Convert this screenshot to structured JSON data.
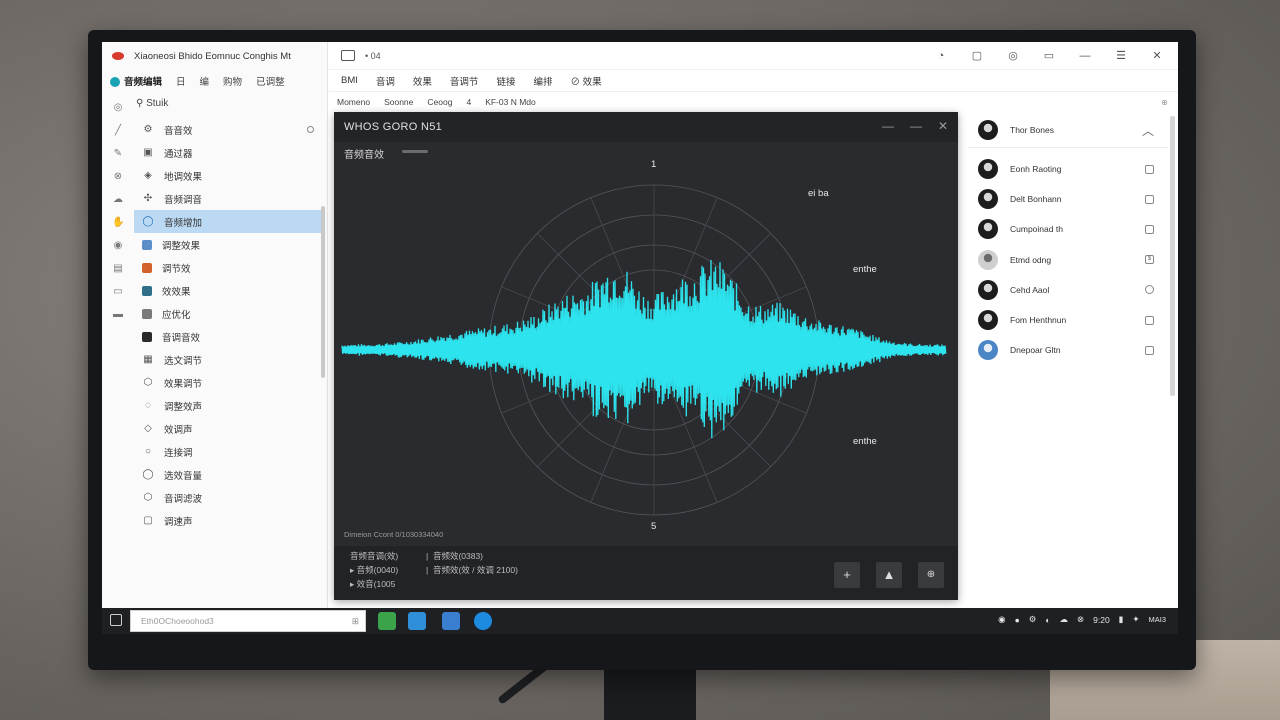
{
  "app": {
    "title": "Xiaoneosi  Bhido Eomnuc Conghis Mt",
    "menu": [
      {
        "label": "音频编辑",
        "active": true
      },
      {
        "label": "日",
        "active": false
      },
      {
        "label": "编",
        "active": false
      },
      {
        "label": "购物",
        "active": false
      },
      {
        "label": "已调整",
        "active": false
      }
    ],
    "search_label": "Stuik"
  },
  "sidebar": {
    "items": [
      {
        "icon": "settings-icon",
        "label": "音音效"
      },
      {
        "icon": "image-icon",
        "label": "通过器"
      },
      {
        "icon": "shield-icon",
        "label": "地调效果"
      },
      {
        "icon": "plugin-icon",
        "label": "音频调音"
      },
      {
        "icon": "wave-icon",
        "label": "音频增加",
        "selected": true
      },
      {
        "icon": "device-icon",
        "label": "调整效果"
      },
      {
        "icon": "filter-icon",
        "label": "调节效"
      },
      {
        "icon": "equalizer-icon",
        "label": "效效果"
      },
      {
        "icon": "clip-icon",
        "label": "应优化"
      },
      {
        "icon": "folder-icon",
        "label": "音调音效"
      },
      {
        "icon": "text-icon",
        "label": "选文调节"
      },
      {
        "icon": "hex-icon",
        "label": "效果调节"
      },
      {
        "icon": "chat-icon",
        "label": "调整效声"
      },
      {
        "icon": "hex-icon",
        "label": "效调声"
      },
      {
        "icon": "circle-icon",
        "label": "连接调"
      },
      {
        "icon": "shield-icon",
        "label": "选效音量"
      },
      {
        "icon": "hex-icon",
        "label": "音调滤波"
      },
      {
        "icon": "box-icon",
        "label": "调速声"
      }
    ]
  },
  "topbar": {
    "doc_title": "04",
    "tools": [
      "BMI",
      "音调",
      "效果",
      "音调节",
      "链接",
      "编排",
      "效果"
    ],
    "breadcrumb": [
      "Momeno",
      "Soonne",
      "Ceoog",
      "4",
      "KF-03 N Mdo"
    ]
  },
  "waveform_window": {
    "title": "WHOS GORO N51",
    "subtitle": "音频音效",
    "top_label": "1",
    "bottom_label": "5",
    "label_top_right": "ei ba",
    "label_right_upper": "enthe",
    "label_right_lower": "enthe",
    "status": "Dimeion Ccont 0/1030334040",
    "footer_lines": [
      {
        "left": "音频音调(效)",
        "right": "音频效(0383)"
      },
      {
        "left": "音频(0040)",
        "right": "音频效(效 / 效调 2100)"
      },
      {
        "left": "效音(1005",
        "right": ""
      }
    ],
    "waveform_color": "#2de3ee"
  },
  "right_panel": {
    "header": "Thor Bones",
    "items": [
      {
        "label": "Eonh Raoting",
        "avatar": "dark"
      },
      {
        "label": "Delt Bonhann",
        "avatar": "dark"
      },
      {
        "label": "Cumpoinad th",
        "avatar": "dark"
      },
      {
        "label": "Etmd odng",
        "avatar": "light"
      },
      {
        "label": "Cehd Aaol",
        "avatar": "dark"
      },
      {
        "label": "Fom Henthnun",
        "avatar": "dark"
      },
      {
        "label": "Dnepoar Gltn",
        "avatar": "blue"
      }
    ]
  },
  "taskbar": {
    "search_placeholder": "Eth0OChoeoohod3",
    "time": "9:20",
    "date": "MAI3"
  }
}
